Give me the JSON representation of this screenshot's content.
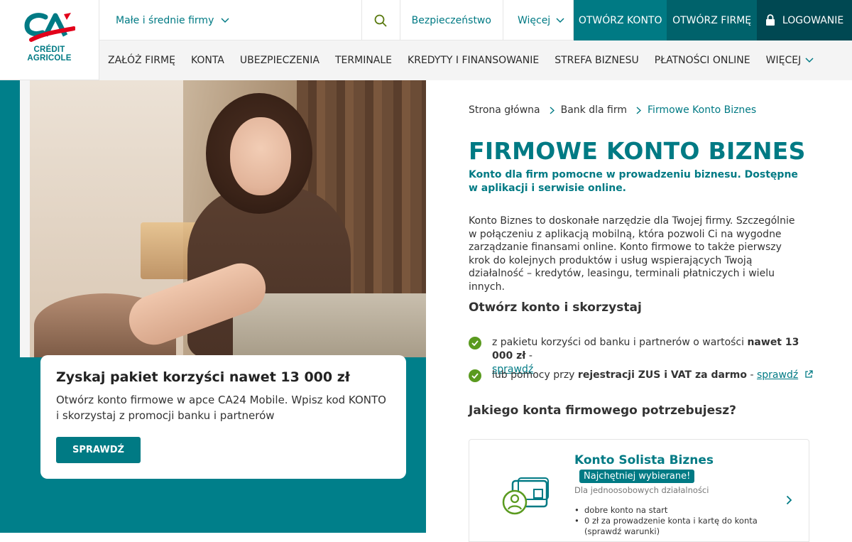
{
  "brand": {
    "logo_text_line1": "CRÉDIT",
    "logo_text_line2": "AGRICOLE",
    "accent": "#007a84",
    "dark_accent": "#004852",
    "check_color": "#5a9a1f"
  },
  "topbar": {
    "segment_label": "Małe i średnie firmy",
    "security_link": "Bezpieczeństwo",
    "more_link": "Więcej",
    "open_account_btn": "Otwórz konto",
    "open_company_btn": "Otwórz firmę",
    "login_btn": "Logowanie"
  },
  "nav": {
    "items": [
      "Załóż firmę",
      "Konta",
      "Ubezpieczenia",
      "Terminale",
      "Kredyty i finansowanie",
      "Strefa biznesu",
      "Płatności online",
      "Więcej"
    ]
  },
  "promo": {
    "title": "Zyskaj pakiet korzyści nawet 13 000 zł",
    "text": "Otwórz konto firmowe w apce CA24 Mobile. Wpisz kod KONTO i skorzystaj z promocji banku i partnerów",
    "button": "Sprawdź"
  },
  "breadcrumb": {
    "items": [
      "Strona główna",
      "Bank dla firm",
      "Firmowe Konto Biznes"
    ]
  },
  "page": {
    "title": "FIRMOWE KONTO BIZNES",
    "subtitle": "Konto dla firm pomocne w prowadzeniu biznesu. Dostępne w aplikacji i serwisie online.",
    "description": "Konto Biznes to doskonałe narzędzie dla Twojej firmy. Szczególnie w połączeniu z aplikacją mobilną, która pozwoli Ci na wygodne zarządzanie finansami online. Konto firmowe to także pierwszy krok do kolejnych produktów i usług wspierających Twoją działalność – kredytów, leasingu, terminali płatniczych i wielu innych."
  },
  "benefits": {
    "heading": "Otwórz konto i skorzystaj",
    "item1_prefix": "z pakietu korzyści od banku i partnerów o wartości ",
    "item1_bold": "nawet 13 000 zł",
    "item1_suffix": " -",
    "item1_link": "sprawdź",
    "item2_prefix": "lub pomocy przy ",
    "item2_bold": "rejestracji ZUS i VAT za darmo",
    "item2_suffix": " - ",
    "item2_link": "sprawdź"
  },
  "accounts": {
    "heading": "Jakiego konta firmowego potrzebujesz?",
    "card": {
      "name": "Konto Solista Biznes",
      "badge": "Najchętniej wybierane!",
      "description": "Dla jednoosobowych działalności",
      "features": [
        "dobre konto na start",
        "0 zł za prowadzenie konta i kartę do konta (sprawdź warunki)"
      ]
    }
  }
}
